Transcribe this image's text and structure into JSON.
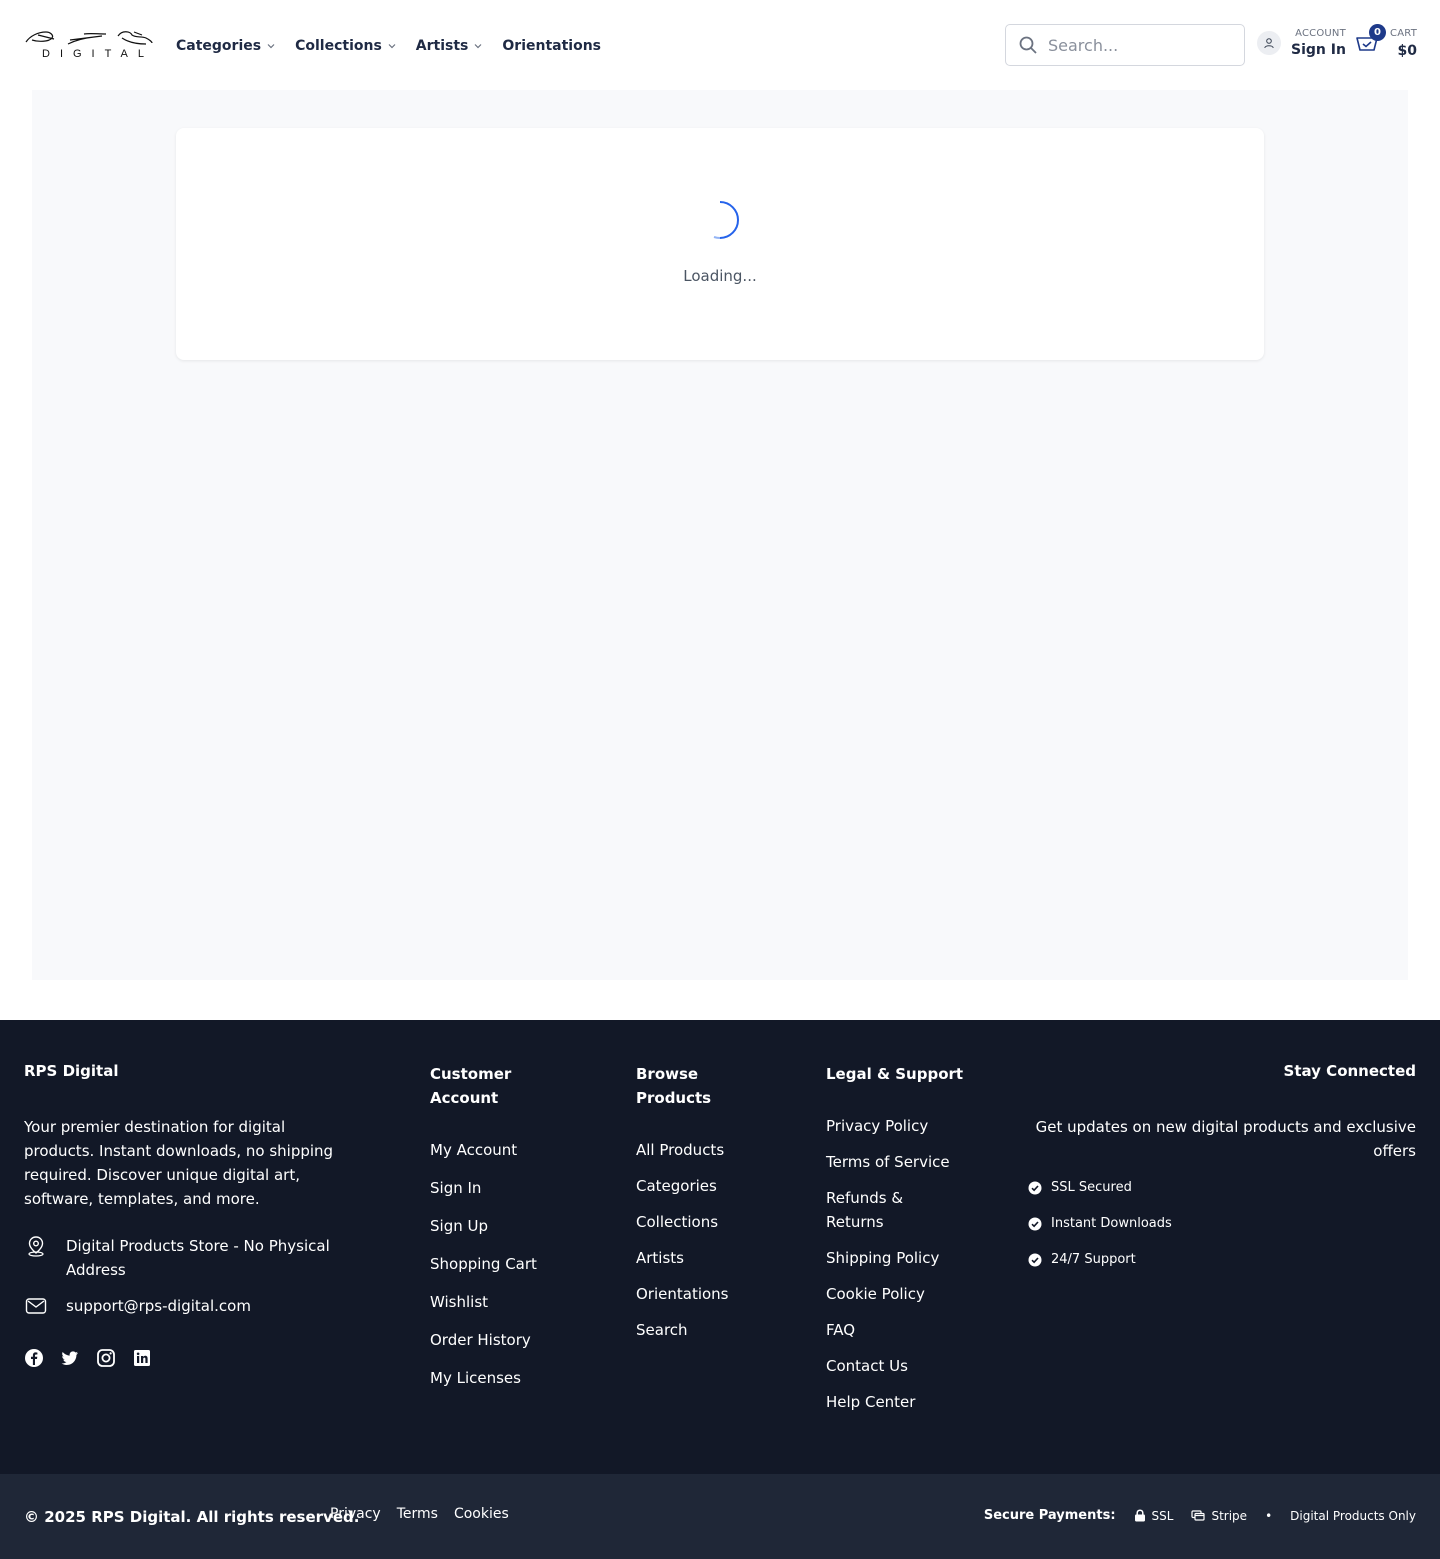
{
  "header": {
    "logo_text": "DIGITAL",
    "nav": [
      {
        "label": "Categories",
        "has_dropdown": true
      },
      {
        "label": "Collections",
        "has_dropdown": true
      },
      {
        "label": "Artists",
        "has_dropdown": true
      },
      {
        "label": "Orientations",
        "has_dropdown": false
      }
    ],
    "search_placeholder": "Search...",
    "account_label": "ACCOUNT",
    "account_action": "Sign In",
    "cart_label": "CART",
    "cart_total": "$0",
    "cart_count": "0"
  },
  "main": {
    "loading_text": "Loading..."
  },
  "footer": {
    "brand": "RPS Digital",
    "description": "Your premier destination for digital products. Instant downloads, no shipping required. Discover unique digital art, software, templates, and more.",
    "address": "Digital Products Store - No Physical Address",
    "email": "support@rps-digital.com",
    "social": [
      "facebook-icon",
      "twitter-icon",
      "instagram-icon",
      "linkedin-icon"
    ],
    "customer_account": {
      "title": "Customer Account",
      "links": [
        "My Account",
        "Sign In",
        "Sign Up",
        "Shopping Cart",
        "Wishlist",
        "Order History",
        "My Licenses"
      ]
    },
    "browse_products": {
      "title": "Browse Products",
      "links": [
        "All Products",
        "Categories",
        "Collections",
        "Artists",
        "Orientations",
        "Search"
      ]
    },
    "legal_support": {
      "title": "Legal & Support",
      "links": [
        "Privacy Policy",
        "Terms of Service",
        "Refunds & Returns",
        "Shipping Policy",
        "Cookie Policy",
        "FAQ",
        "Contact Us",
        "Help Center"
      ]
    },
    "stay_connected": {
      "title": "Stay Connected",
      "description": "Get updates on new digital products and exclusive offers",
      "badges": [
        "SSL Secured",
        "Instant Downloads",
        "24/7 Support"
      ]
    }
  },
  "bottom": {
    "copyright": "© 2025 RPS Digital. All rights reserved.",
    "links": [
      "Privacy",
      "Terms",
      "Cookies"
    ],
    "secure_label": "Secure Payments:",
    "ssl": "SSL",
    "stripe": "Stripe",
    "separator": "•",
    "digital_only": "Digital Products Only"
  },
  "colors": {
    "navy": "#1f2a44",
    "footer_bg": "#121827",
    "bottom_bg": "#1f2737",
    "badge_blue": "#1e3a8a",
    "spinner_blue": "#2563eb"
  }
}
